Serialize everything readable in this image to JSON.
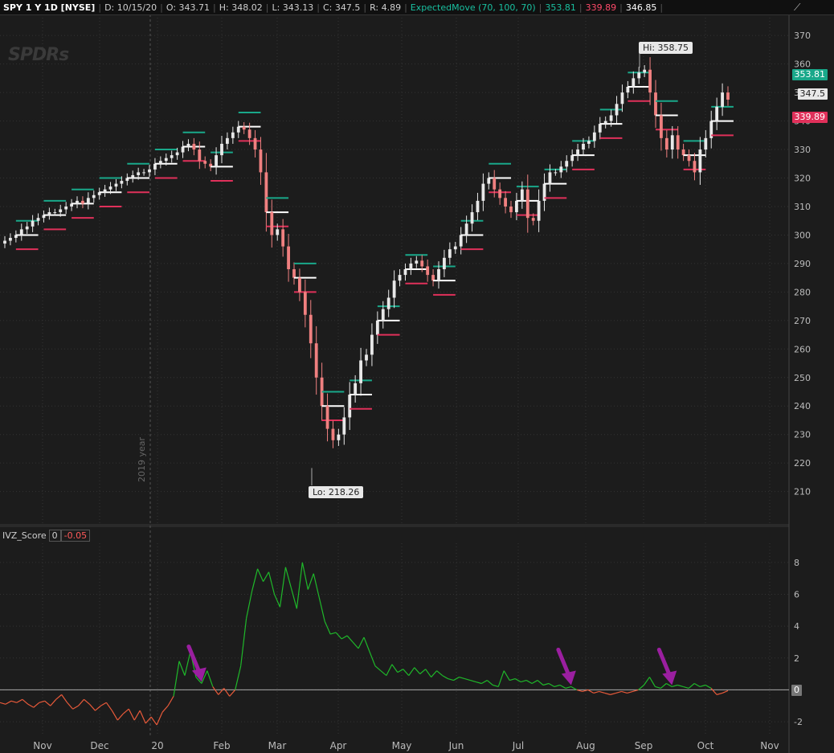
{
  "header": {
    "symbol": "SPY 1 Y 1D [NYSE]",
    "date": "D: 10/15/20",
    "open": "O: 343.71",
    "high": "H: 348.02",
    "low": "L: 343.13",
    "close": "C: 347.5",
    "range": "R: 4.89",
    "study": "ExpectedMove (70, 100, 70)",
    "study_upper": "353.81",
    "study_lower": "339.89",
    "study_mid": "346.85"
  },
  "watermark": "SPDRs",
  "year_marker": "2019 year",
  "callouts": {
    "high": "Hi: 358.75",
    "low": "Lo: 218.26"
  },
  "price_tags": {
    "upper": "353.81",
    "last": "347.5",
    "lower": "339.89"
  },
  "lower_study": {
    "name": "IVZ_Score",
    "param": "0",
    "value": "-0.05",
    "zero_tag": "0"
  },
  "colors": {
    "up_candle": "#e8e8e8",
    "down_candle": "#f08080",
    "upper_band": "#19a88a",
    "lower_band": "#e0305a",
    "osc_positive": "#1fb82a",
    "osc_negative": "#e85a3a",
    "arrow": "#9b1fa0",
    "background": "#1c1c1c"
  },
  "chart_data": [
    {
      "type": "candlestick",
      "title": "SPY 1 Y 1D [NYSE]",
      "y_ticks": [
        "210",
        "220",
        "230",
        "240",
        "250",
        "260",
        "270",
        "280",
        "290",
        "300",
        "310",
        "320",
        "330",
        "340",
        "350",
        "360",
        "370"
      ],
      "ylim": [
        202,
        374
      ],
      "x_ticks": [
        "Nov",
        "Dec",
        "20",
        "Feb",
        "Mar",
        "Apr",
        "May",
        "Jun",
        "Jul",
        "Aug",
        "Sep",
        "Oct",
        "Nov"
      ],
      "close_series": [
        298,
        299,
        300,
        302,
        303,
        305,
        306,
        307,
        308,
        308,
        309,
        310,
        311,
        312,
        311,
        313,
        314,
        315,
        316,
        317,
        318,
        319,
        320,
        321,
        322,
        322,
        323,
        325,
        326,
        327,
        328,
        329,
        331,
        332,
        330,
        326,
        325,
        324,
        328,
        332,
        334,
        336,
        338,
        337,
        334,
        330,
        322,
        308,
        300,
        302,
        296,
        288,
        285,
        280,
        272,
        262,
        250,
        240,
        232,
        228,
        230,
        236,
        244,
        248,
        256,
        258,
        265,
        270,
        274,
        278,
        284,
        286,
        288,
        290,
        291,
        289,
        286,
        284,
        288,
        292,
        295,
        296,
        300,
        304,
        308,
        312,
        318,
        320,
        316,
        313,
        310,
        308,
        312,
        316,
        306,
        305,
        312,
        318,
        322,
        322,
        324,
        326,
        328,
        330,
        332,
        333,
        336,
        339,
        340,
        342,
        346,
        350,
        352,
        355,
        357,
        358,
        350,
        342,
        334,
        330,
        335,
        330,
        328,
        326,
        322,
        330,
        334,
        340,
        345,
        350,
        347.5
      ],
      "hi": {
        "value": 358.75,
        "label": "Hi: 358.75"
      },
      "lo": {
        "value": 218.26,
        "label": "Lo: 218.26"
      }
    },
    {
      "type": "line",
      "title": "IVZ_Score",
      "y_ticks": [
        "8",
        "6",
        "4",
        "2",
        "0",
        "-2"
      ],
      "ylim": [
        -2.4,
        8.6
      ],
      "values": [
        -0.8,
        -0.9,
        -0.7,
        -0.8,
        -0.6,
        -0.9,
        -1.1,
        -0.8,
        -0.7,
        -1.0,
        -0.6,
        -0.3,
        -0.8,
        -1.2,
        -1.0,
        -0.6,
        -0.9,
        -1.3,
        -1.0,
        -0.8,
        -1.3,
        -1.9,
        -1.5,
        -1.2,
        -1.9,
        -1.3,
        -2.1,
        -1.7,
        -2.2,
        -1.4,
        -1.0,
        -0.4,
        1.8,
        0.9,
        2.4,
        0.8,
        0.4,
        1.2,
        0.2,
        -0.3,
        0.1,
        -0.4,
        0.0,
        1.5,
        4.5,
        6.2,
        7.6,
        6.8,
        7.4,
        6.0,
        5.2,
        7.7,
        6.4,
        5.1,
        8.0,
        6.3,
        7.3,
        5.8,
        4.3,
        3.5,
        3.6,
        3.2,
        3.4,
        3.0,
        2.6,
        3.3,
        2.4,
        1.5,
        1.2,
        0.9,
        1.6,
        1.1,
        1.3,
        0.9,
        1.4,
        1.0,
        1.3,
        0.8,
        1.2,
        0.9,
        0.7,
        0.6,
        0.8,
        0.7,
        0.6,
        0.5,
        0.4,
        0.6,
        0.3,
        0.2,
        1.2,
        0.6,
        0.7,
        0.5,
        0.6,
        0.4,
        0.6,
        0.3,
        0.4,
        0.2,
        0.3,
        0.1,
        0.2,
        0.0,
        -0.1,
        0.0,
        -0.2,
        -0.1,
        -0.2,
        -0.3,
        -0.2,
        -0.1,
        -0.2,
        -0.1,
        0.0,
        0.3,
        0.8,
        0.2,
        0.1,
        0.4,
        0.2,
        0.3,
        0.2,
        0.1,
        0.4,
        0.2,
        0.3,
        0.1,
        -0.3,
        -0.2,
        -0.05
      ],
      "arrow_positions": [
        36,
        102,
        120
      ]
    }
  ]
}
